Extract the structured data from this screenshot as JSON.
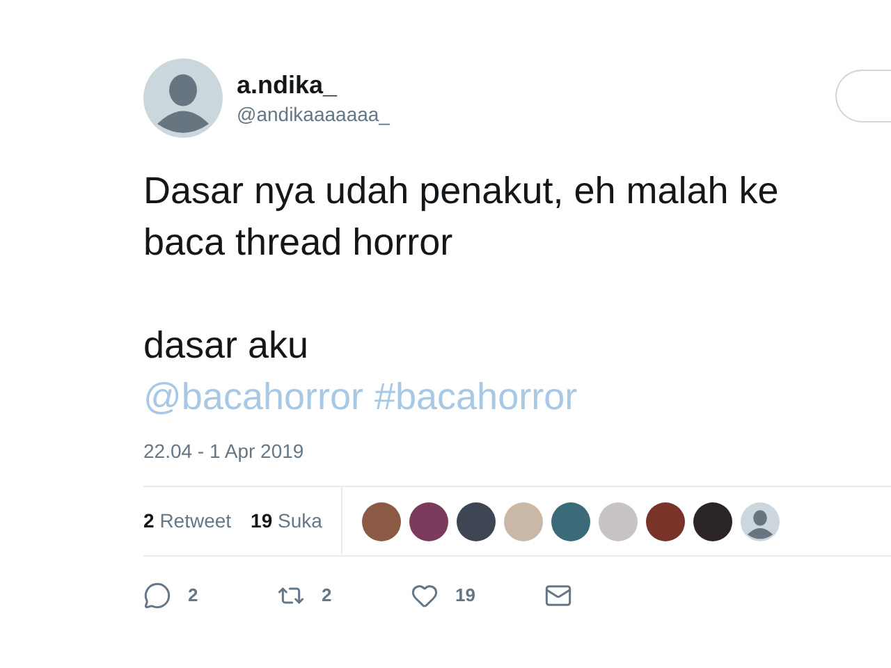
{
  "author": {
    "name": "a.ndika_",
    "handle": "@andikaaaaaaa_"
  },
  "tweet": {
    "paragraphs": [
      [
        "Dasar nya udah penakut, eh malah ke",
        "baca thread horror"
      ],
      [
        "dasar aku"
      ]
    ],
    "links": [
      "@bacahorror",
      "#bacahorror"
    ],
    "timestamp": "22.04 - 1 Apr 2019"
  },
  "stats": [
    {
      "count": "2",
      "label": "Retweet"
    },
    {
      "count": "19",
      "label": "Suka"
    }
  ],
  "likers": [
    {
      "kind": "photo"
    },
    {
      "kind": "photo"
    },
    {
      "kind": "photo"
    },
    {
      "kind": "photo"
    },
    {
      "kind": "photo"
    },
    {
      "kind": "photo"
    },
    {
      "kind": "photo"
    },
    {
      "kind": "photo"
    },
    {
      "kind": "default"
    }
  ],
  "actions": [
    {
      "kind": "reply",
      "count": "2"
    },
    {
      "kind": "retweet",
      "count": "2"
    },
    {
      "kind": "like",
      "count": "19"
    },
    {
      "kind": "message"
    }
  ]
}
